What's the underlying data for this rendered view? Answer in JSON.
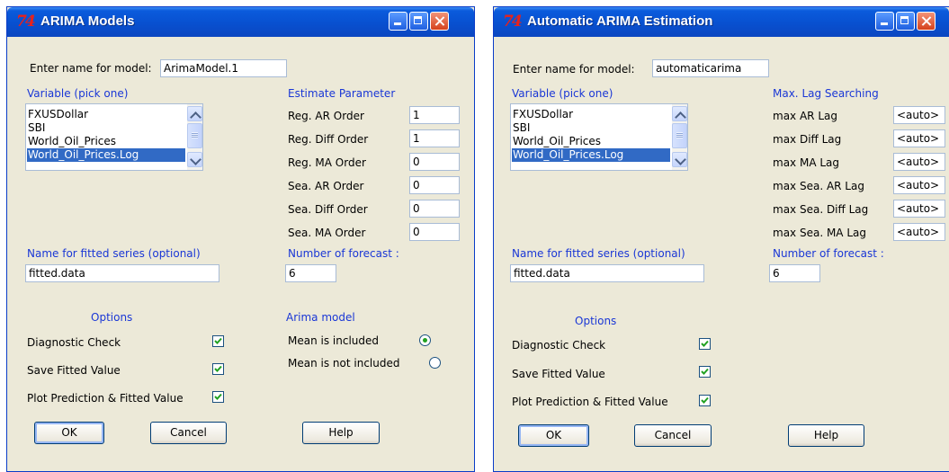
{
  "window1": {
    "icon": "74",
    "title": "ARIMA Models",
    "name_label": "Enter name for model:",
    "name_value": "ArimaModel.1",
    "variable_label": "Variable (pick one)",
    "variables": [
      "FXUSDollar",
      "SBI",
      "World_Oil_Prices",
      "World_Oil_Prices.Log"
    ],
    "selected_variable": "World_Oil_Prices.Log",
    "param_header": "Estimate Parameter",
    "params": [
      {
        "label": "Reg. AR Order",
        "value": "1"
      },
      {
        "label": "Reg. Diff Order",
        "value": "1"
      },
      {
        "label": "Reg. MA Order",
        "value": "0"
      },
      {
        "label": "Sea. AR Order",
        "value": "0"
      },
      {
        "label": "Sea. Diff Order",
        "value": "0"
      },
      {
        "label": "Sea. MA Order",
        "value": "0"
      }
    ],
    "fitted_label": "Name for fitted series (optional)",
    "fitted_value": "fitted.data",
    "forecast_label": "Number of forecast :",
    "forecast_value": "6",
    "options_header": "Options",
    "options": [
      {
        "label": "Diagnostic Check",
        "checked": true
      },
      {
        "label": "Save Fitted Value",
        "checked": true
      },
      {
        "label": "Plot Prediction & Fitted Value",
        "checked": true
      }
    ],
    "model_header": "Arima model",
    "model_options": [
      {
        "label": "Mean is included",
        "selected": true
      },
      {
        "label": "Mean is not included",
        "selected": false
      }
    ],
    "ok": "OK",
    "cancel": "Cancel",
    "help": "Help"
  },
  "window2": {
    "icon": "74",
    "title": "Automatic ARIMA Estimation",
    "name_label": "Enter name for model:",
    "name_value": "automaticarima",
    "variable_label": "Variable (pick one)",
    "variables": [
      "FXUSDollar",
      "SBI",
      "World_Oil_Prices",
      "World_Oil_Prices.Log"
    ],
    "selected_variable": "World_Oil_Prices.Log",
    "lag_header": "Max. Lag Searching",
    "lags": [
      {
        "label": "max AR Lag",
        "value": "<auto>"
      },
      {
        "label": "max Diff Lag",
        "value": "<auto>"
      },
      {
        "label": "max MA Lag",
        "value": "<auto>"
      },
      {
        "label": "max Sea. AR Lag",
        "value": "<auto>"
      },
      {
        "label": "max Sea. Diff Lag",
        "value": "<auto>"
      },
      {
        "label": "max Sea. MA Lag",
        "value": "<auto>"
      }
    ],
    "fitted_label": "Name for fitted series (optional)",
    "fitted_value": "fitted.data",
    "forecast_label": "Number of forecast :",
    "forecast_value": "6",
    "options_header": "Options",
    "options": [
      {
        "label": "Diagnostic Check",
        "checked": true
      },
      {
        "label": "Save Fitted Value",
        "checked": true
      },
      {
        "label": "Plot Prediction & Fitted Value",
        "checked": true
      }
    ],
    "ok": "OK",
    "cancel": "Cancel",
    "help": "Help"
  },
  "colors": {
    "titlebar": "#0a5bdc",
    "section_label": "#1a37d6",
    "selection": "#316ac5",
    "dialog_bg": "#ece9d8",
    "icon": "#e8221b"
  }
}
